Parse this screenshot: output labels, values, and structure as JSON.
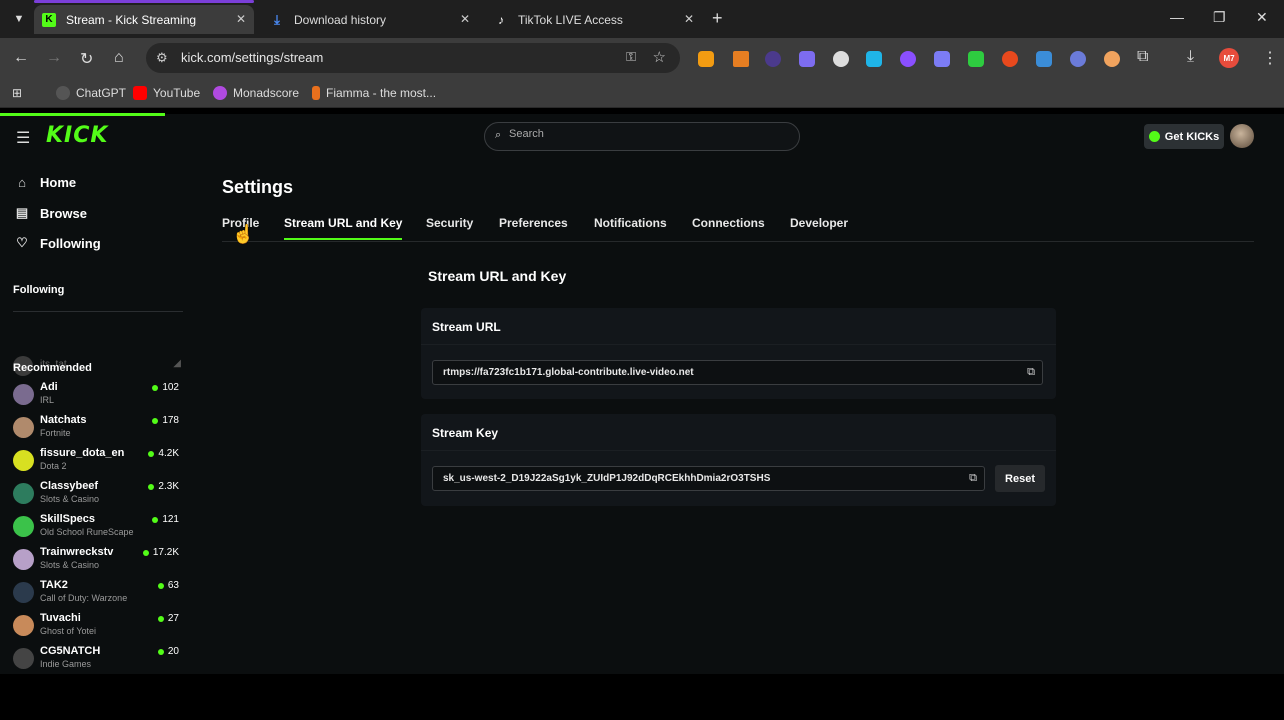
{
  "browser": {
    "tabs": [
      {
        "title": "Stream - Kick Streaming",
        "favicon": "kick-favicon"
      },
      {
        "title": "Download history",
        "favicon": "download-icon"
      },
      {
        "title": "TikTok LIVE Access",
        "favicon": "tiktok-favicon"
      }
    ],
    "url": "kick.com/settings/stream",
    "bookmarks": [
      {
        "label": "ChatGPT"
      },
      {
        "label": "YouTube"
      },
      {
        "label": "Monadscore"
      },
      {
        "label": "Fiamma - the most..."
      }
    ],
    "profile_initials": "M7"
  },
  "site": {
    "logo": "KICK",
    "search_placeholder": "Search",
    "get_kicks": "Get KICKs"
  },
  "sidebar": {
    "nav": [
      {
        "label": "Home",
        "icon": "home-icon"
      },
      {
        "label": "Browse",
        "icon": "browse-icon"
      },
      {
        "label": "Following",
        "icon": "heart-icon"
      }
    ],
    "following_heading": "Following",
    "following": [
      {
        "name": "its_tat"
      }
    ],
    "recommended_heading": "Recommended",
    "recommended": [
      {
        "name": "Adi",
        "category": "IRL",
        "viewers": "102"
      },
      {
        "name": "Natchats",
        "category": "Fortnite",
        "viewers": "178"
      },
      {
        "name": "fissure_dota_en",
        "category": "Dota 2",
        "viewers": "4.2K"
      },
      {
        "name": "Classybeef",
        "category": "Slots & Casino",
        "viewers": "2.3K"
      },
      {
        "name": "SkillSpecs",
        "category": "Old School RuneScape",
        "viewers": "121"
      },
      {
        "name": "Trainwreckstv",
        "category": "Slots & Casino",
        "viewers": "17.2K"
      },
      {
        "name": "TAK2",
        "category": "Call of Duty: Warzone",
        "viewers": "63"
      },
      {
        "name": "Tuvachi",
        "category": "Ghost of Yotei",
        "viewers": "27"
      },
      {
        "name": "CG5NATCH",
        "category": "Indie Games",
        "viewers": "20"
      }
    ]
  },
  "settings": {
    "title": "Settings",
    "tabs": [
      "Profile",
      "Stream URL and Key",
      "Security",
      "Preferences",
      "Notifications",
      "Connections",
      "Developer"
    ],
    "active_tab": "Stream URL and Key",
    "section_title": "Stream URL and Key",
    "stream_url": {
      "heading": "Stream URL",
      "value": "rtmps://fa723fc1b171.global-contribute.live-video.net"
    },
    "stream_key": {
      "heading": "Stream Key",
      "value": "sk_us-west-2_D19J22aSg1yk_ZUIdP1J92dDqRCEkhhDmia2rO3TSHS",
      "reset_label": "Reset"
    }
  },
  "colors": {
    "accent": "#53fc18",
    "page_bg": "#0b0e0f",
    "card_bg": "#12161a"
  }
}
